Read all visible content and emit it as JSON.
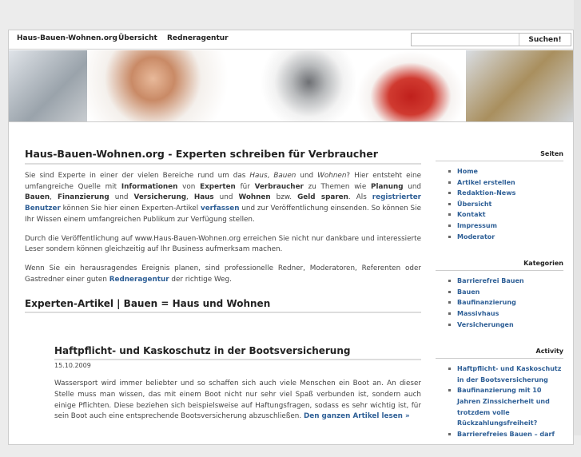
{
  "nav": {
    "items": [
      "Haus-Bauen-Wohnen.org",
      "Übersicht",
      "Redneragentur"
    ],
    "search_placeholder": "",
    "search_button": "Suchen!"
  },
  "main": {
    "title": "Haus-Bauen-Wohnen.org - Experten schreiben für Verbraucher",
    "p1": [
      "Sie sind Experte in einer der vielen Bereiche rund um das ",
      "Haus",
      ", ",
      "Bauen",
      " und ",
      "Wohnen",
      "? Hier entsteht eine umfangreiche Quelle mit ",
      "Informationen",
      " von ",
      "Experten",
      " für ",
      "Verbraucher",
      " zu Themen wie ",
      "Planung",
      " und ",
      "Bauen",
      ", ",
      "Finanzierung",
      " und ",
      "Versicherung",
      ", ",
      "Haus",
      " und ",
      "Wohnen",
      " bzw. ",
      "Geld sparen",
      ". Als ",
      "registrierter Benutzer",
      " können Sie hier einen Experten-Artikel ",
      "verfassen",
      " und zur Veröffentlichung einsenden. So können Sie Ihr Wissen einem umfangreichen Publikum zur Verfügung stellen."
    ],
    "p2": "Durch die Veröffentlichung auf www.Haus-Bauen-Wohnen.org erreichen Sie nicht nur dankbare und interessierte Leser sondern können gleichzeitig auf Ihr Business aufmerksam machen.",
    "p3a": "Wenn Sie ein herausragendes Ereignis planen, sind professionelle Redner, Moderatoren, Referenten oder Gastredner einer guten ",
    "p3link": "Redneragentur",
    "p3b": " der richtige Weg.",
    "section_title": "Experten-Artikel | Bauen = Haus und Wohnen",
    "post": {
      "title": "Haftpflicht- und Kaskoschutz in der Bootsversicherung",
      "date": "15.10.2009",
      "excerpt": "Wassersport wird immer beliebter und so schaffen sich auch viele Menschen ein Boot an. An dieser Stelle muss man wissen, das mit einem Boot nicht nur sehr viel Spaß verbunden ist, sondern auch einige Pflichten. Diese beziehen sich beispielsweise auf Haftungsfragen, sodass es sehr wichtig ist, für sein Boot auch eine entsprechende Bootsversicherung abzuschließen. ",
      "more": "Den ganzen Artikel lesen »"
    }
  },
  "sidebar": {
    "seiten": {
      "title": "Seiten",
      "items": [
        "Home",
        "Artikel erstellen",
        "Redaktion-News",
        "Übersicht",
        "Kontakt",
        "Impressum",
        "Moderator"
      ]
    },
    "kategorien": {
      "title": "Kategorien",
      "items": [
        "Barrierefrei Bauen",
        "Bauen",
        "Baufinanzierung",
        "Massivhaus",
        "Versicherungen"
      ]
    },
    "activity": {
      "title": "Activity",
      "items": [
        "Haftpflicht- und Kaskoschutz in der Bootsversicherung",
        "Baufinanzierung mit 10 Jahren Zinssicherheit und trotzdem volle Rückzahlungsfreiheit?",
        "Barrierefreies Bauen – darf"
      ]
    }
  }
}
